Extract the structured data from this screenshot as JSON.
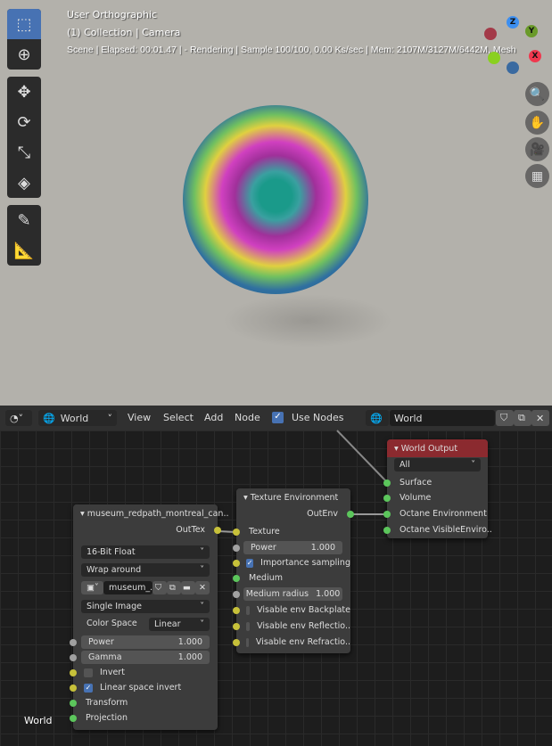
{
  "viewport": {
    "overlay": [
      "User Orthographic",
      "(1) Collection | Camera",
      "Scene | Elapsed: 00:01.47 |  - Rendering | Sample 100/100, 0.00 Ks/sec | Mem: 2107M/3127M/6442M, Mesh"
    ],
    "axes": {
      "z": "Z",
      "y": "Y",
      "x": "X"
    },
    "tools": [
      "select-box-icon",
      "cursor-icon",
      "move-icon",
      "rotate-icon",
      "scale-icon",
      "transform-icon",
      "annotate-icon",
      "measure-icon"
    ],
    "nav": [
      "zoom-icon",
      "hand-icon",
      "camera-icon",
      "grid-icon"
    ]
  },
  "editor_header": {
    "world_type": "World",
    "menus": [
      "View",
      "Select",
      "Add",
      "Node"
    ],
    "use_nodes_label": "Use Nodes",
    "use_nodes": true,
    "world_name": "World"
  },
  "nodes": {
    "image": {
      "title": "museum_redpath_montreal_can..",
      "output": "OutTex",
      "format": "16-Bit Float",
      "wrap": "Wrap around",
      "image_name": "museum_..",
      "source": "Single Image",
      "color_space_label": "Color Space",
      "color_space": "Linear",
      "power_label": "Power",
      "power": "1.000",
      "gamma_label": "Gamma",
      "gamma": "1.000",
      "invert_label": "Invert",
      "invert": false,
      "linear_label": "Linear space invert",
      "linear": true,
      "transform": "Transform",
      "projection": "Projection"
    },
    "texenv": {
      "title": "Texture Environment",
      "output": "OutEnv",
      "texture": "Texture",
      "power_label": "Power",
      "power": "1.000",
      "importance_label": "Importance sampling",
      "importance": true,
      "medium": "Medium",
      "radius_label": "Medium radius",
      "radius": "1.000",
      "backplate": "Visable env Backplate",
      "reflection": "Visable env Reflectio..",
      "refraction": "Visable env Refractio.."
    },
    "output": {
      "title": "World Output",
      "target": "All",
      "inputs": [
        "Surface",
        "Volume",
        "Octane Environment",
        "Octane VisibleEnviro.."
      ]
    }
  },
  "footer_label": "World",
  "colors": {
    "active_tool": "#4772b3",
    "output_header": "#8b2a2f",
    "socket_yellow": "#c7c13a",
    "socket_green": "#5cc65c"
  }
}
